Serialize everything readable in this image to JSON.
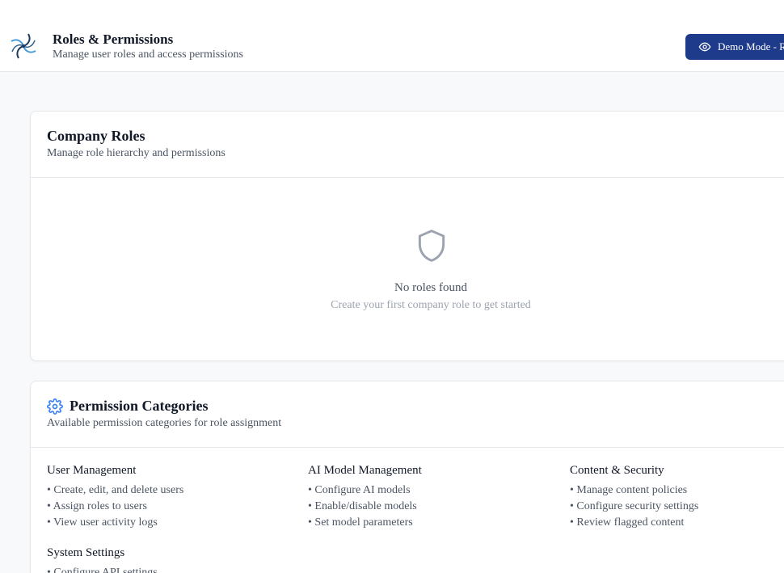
{
  "header": {
    "title": "Roles & Permissions",
    "subtitle": "Manage user roles and access permissions",
    "demo_label": "Demo Mode - R"
  },
  "roles_card": {
    "title": "Company Roles",
    "description": "Manage role hierarchy and permissions",
    "empty_title": "No roles found",
    "empty_subtitle": "Create your first company role to get started"
  },
  "permissions_card": {
    "title": "Permission Categories",
    "description": "Available permission categories for role assignment",
    "categories": [
      {
        "title": "User Management",
        "items": [
          "• Create, edit, and delete users",
          "• Assign roles to users",
          "• View user activity logs"
        ]
      },
      {
        "title": "AI Model Management",
        "items": [
          "• Configure AI models",
          "• Enable/disable models",
          "• Set model parameters"
        ]
      },
      {
        "title": "Content & Security",
        "items": [
          "• Manage content policies",
          "• Configure security settings",
          "• Review flagged content"
        ]
      },
      {
        "title": "System Settings",
        "items": [
          "• Configure API settings"
        ]
      }
    ]
  },
  "colors": {
    "accent": "#1e3a8a",
    "icon_blue": "#3b82f6",
    "muted": "#9ca3af"
  },
  "icons": {
    "logo": "spiral-logo-icon",
    "demo": "eye-icon",
    "empty": "shield-icon",
    "perm": "gear-icon"
  }
}
